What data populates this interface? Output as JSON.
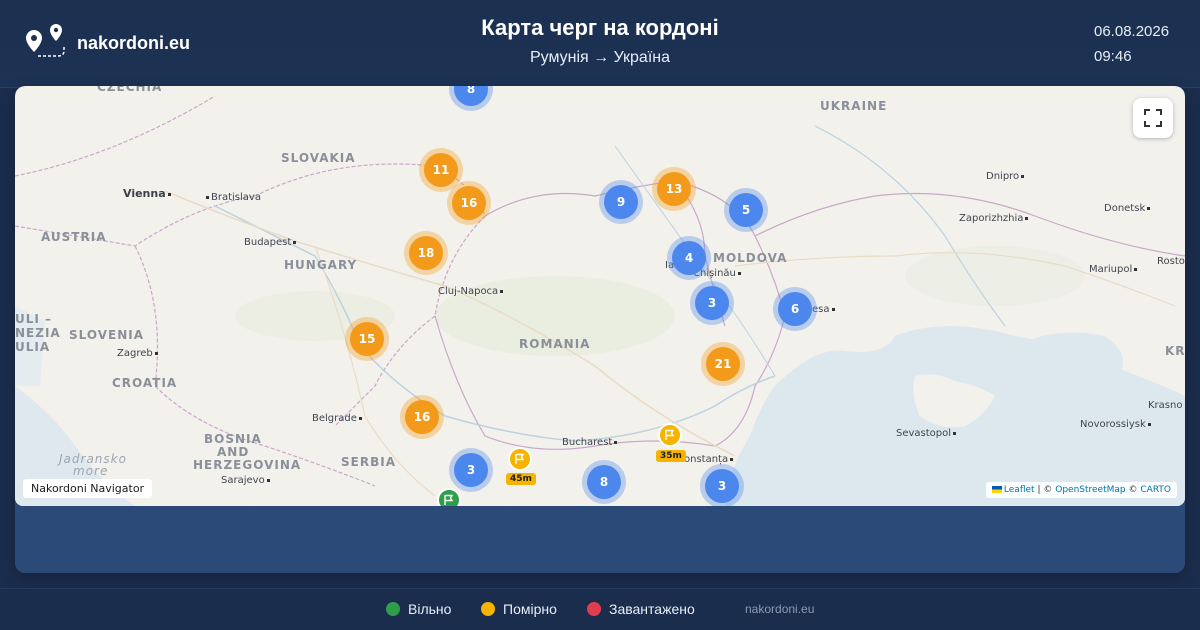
{
  "header": {
    "brand": "nakordoni.eu",
    "title": "Карта черг на кордоні",
    "route": "Румунія → Україна",
    "date": "06.08.2026",
    "time": "09:46"
  },
  "map": {
    "countries": [
      "CZECHIA",
      "SLOVAKIA",
      "AUSTRIA",
      "HUNGARY",
      "SLOVENIA",
      "CROATIA",
      "BOSNIA",
      "AND",
      "HERZEGOVINA",
      "SERBIA",
      "ROMANIA",
      "UKRAINE",
      "MOLDOVA",
      "KRA",
      "ULI –",
      "NEZIA",
      "ULIA",
      "Jadransko",
      "more"
    ],
    "cities": [
      "Vienna",
      "Bratislava",
      "Budapest",
      "Cluj-Napoca",
      "Zagreb",
      "Belgrade",
      "Sarajevo",
      "Bucharest",
      "Constanța",
      "Chișinău",
      "Ia",
      "esa",
      "Dnipro",
      "Zaporizhzhia",
      "Donetsk",
      "Mariupol",
      "Rosto",
      "Sevastopol",
      "Novorossiysk",
      "Krasno"
    ],
    "clusters": [
      {
        "count": "8",
        "color": "blue"
      },
      {
        "count": "11",
        "color": "orange"
      },
      {
        "count": "16",
        "color": "orange"
      },
      {
        "count": "18",
        "color": "orange"
      },
      {
        "count": "15",
        "color": "orange"
      },
      {
        "count": "16",
        "color": "orange"
      },
      {
        "count": "9",
        "color": "blue"
      },
      {
        "count": "13",
        "color": "orange"
      },
      {
        "count": "5",
        "color": "blue"
      },
      {
        "count": "4",
        "color": "blue"
      },
      {
        "count": "3",
        "color": "blue"
      },
      {
        "count": "6",
        "color": "blue"
      },
      {
        "count": "21",
        "color": "orange"
      },
      {
        "count": "3",
        "color": "blue"
      },
      {
        "count": "8",
        "color": "blue"
      },
      {
        "count": "3",
        "color": "blue"
      }
    ],
    "pins": [
      {
        "label": "45m",
        "color": "#f6b400"
      },
      {
        "label": "35m",
        "color": "#f6b400"
      },
      {
        "label": "",
        "color": "#2e9e4a"
      }
    ],
    "fullscreen_icon": "fullscreen-icon",
    "navigator_label": "Nakordoni Navigator",
    "attribution": {
      "leaflet": "Leaflet",
      "sep1": "| ©",
      "osm": "OpenStreetMap",
      "sep2": "©",
      "carto": "CARTO"
    }
  },
  "legend": {
    "items": [
      {
        "label": "Вільно",
        "color": "#2e9e4a"
      },
      {
        "label": "Помірно",
        "color": "#f6b400"
      },
      {
        "label": "Завантажено",
        "color": "#e23d4e"
      }
    ],
    "site": "nakordoni.eu"
  }
}
